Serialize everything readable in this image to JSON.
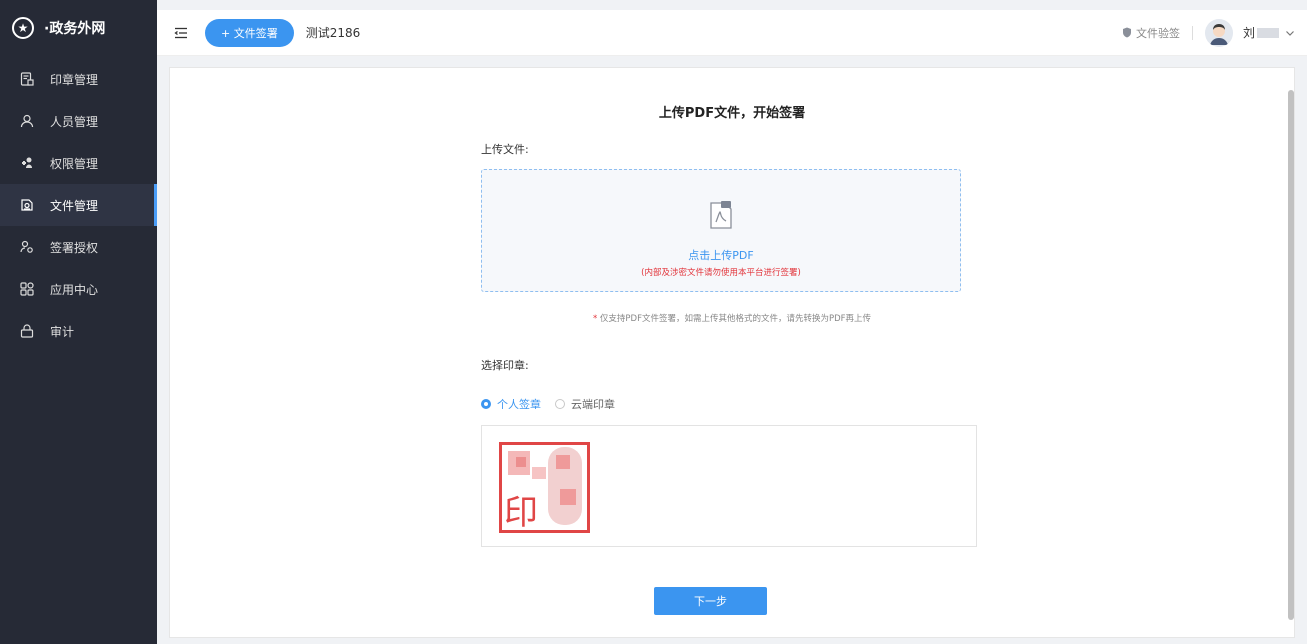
{
  "brand": {
    "name": "·政务外网",
    "logo_icon": "star-badge-icon"
  },
  "sidebar": {
    "items": [
      {
        "label": "印章管理",
        "icon": "seal-doc-icon"
      },
      {
        "label": "人员管理",
        "icon": "user-icon"
      },
      {
        "label": "权限管理",
        "icon": "permission-icon"
      },
      {
        "label": "文件管理",
        "icon": "file-icon",
        "active": true
      },
      {
        "label": "签署授权",
        "icon": "authorize-icon"
      },
      {
        "label": "应用中心",
        "icon": "apps-icon"
      },
      {
        "label": "审计",
        "icon": "lock-icon"
      }
    ]
  },
  "header": {
    "sign_button": "+ 文件签署",
    "tab_name": "测试2186",
    "verify_label": "文件验签",
    "user_name": "刘"
  },
  "main": {
    "title": "上传PDF文件，开始签署",
    "upload_label": "上传文件:",
    "upload_action": "点击上传PDF",
    "upload_warning": "(内部及涉密文件请勿使用本平台进行签署)",
    "hint_star": "*",
    "hint_text": " 仅支持PDF文件签署，如需上传其他格式的文件，请先转换为PDF再上传",
    "seal_label": "选择印章:",
    "radio_personal": "个人签章",
    "radio_cloud": "云端印章",
    "seal_char": "印",
    "next_button": "下一步"
  },
  "colors": {
    "primary": "#3b95f0",
    "sidebar_bg": "#262a36",
    "danger": "#e2353b",
    "seal": "#e04646"
  }
}
